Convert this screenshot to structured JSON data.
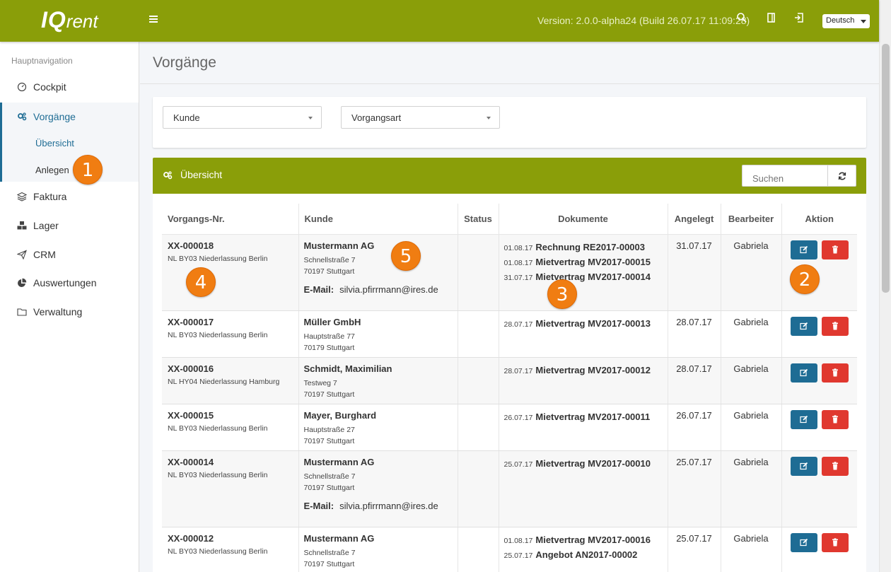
{
  "header": {
    "logo_main": "IQ",
    "logo_sub": "rent",
    "version": "Version: 2.0.0-alpha24 (Build 26.07.17 11:09:28)",
    "language": "Deutsch",
    "icons": [
      "menu-icon",
      "search-icon",
      "bookmark-icon",
      "logout-icon"
    ],
    "accent_color": "#8a9e09"
  },
  "sidebar": {
    "header": "Hauptnavigation",
    "items": [
      {
        "label": "Cockpit",
        "icon": "gauge-icon"
      },
      {
        "label": "Vorgänge",
        "icon": "cogs-icon",
        "active": true
      },
      {
        "label": "Faktura",
        "icon": "layers-icon"
      },
      {
        "label": "Lager",
        "icon": "cubes-icon"
      },
      {
        "label": "CRM",
        "icon": "paper-plane-icon"
      },
      {
        "label": "Auswertungen",
        "icon": "pie-chart-icon"
      },
      {
        "label": "Verwaltung",
        "icon": "folder-icon"
      }
    ],
    "sub_items": [
      {
        "label": "Übersicht",
        "active": true
      },
      {
        "label": "Anlegen"
      }
    ],
    "active_color": "#1e6c94"
  },
  "main": {
    "title": "Vorgänge",
    "filters": [
      {
        "label": "Kunde"
      },
      {
        "label": "Vorgangsart"
      }
    ],
    "panel": {
      "title": "Übersicht",
      "search_placeholder": "Suchen"
    },
    "table": {
      "columns": [
        "Vorgangs-Nr.",
        "Kunde",
        "Status",
        "Dokumente",
        "Angelegt",
        "Bearbeiter",
        "Aktion"
      ],
      "rows": [
        {
          "nr": "XX-000018",
          "branch": "NL BY03 Niederlassung Berlin",
          "customer": "Mustermann AG",
          "street": "Schnellstraße 7",
          "city": "70197 Stuttgart",
          "email_label": "E-Mail:",
          "email": "silvia.pfirrmann@ires.de",
          "status": "",
          "docs": [
            {
              "date": "01.08.17",
              "name": "Rechnung RE2017-00003"
            },
            {
              "date": "01.08.17",
              "name": "Mietvertrag MV2017-00015"
            },
            {
              "date": "31.07.17",
              "name": "Mietvertrag MV2017-00014"
            }
          ],
          "created": "31.07.17",
          "editor": "Gabriela"
        },
        {
          "nr": "XX-000017",
          "branch": "NL BY03 Niederlassung Berlin",
          "customer": "Müller GmbH",
          "street": "Hauptstraße 77",
          "city": "70179 Stuttgart",
          "status": "",
          "docs": [
            {
              "date": "28.07.17",
              "name": "Mietvertrag MV2017-00013"
            }
          ],
          "created": "28.07.17",
          "editor": "Gabriela"
        },
        {
          "nr": "XX-000016",
          "branch": "NL HY04 Niederlassung Hamburg",
          "customer": "Schmidt, Maximilian",
          "street": "Testweg 7",
          "city": "70197 Stuttgart",
          "status": "",
          "docs": [
            {
              "date": "28.07.17",
              "name": "Mietvertrag MV2017-00012"
            }
          ],
          "created": "28.07.17",
          "editor": "Gabriela"
        },
        {
          "nr": "XX-000015",
          "branch": "NL BY03 Niederlassung Berlin",
          "customer": "Mayer, Burghard",
          "street": "Hauptstraße 27",
          "city": "70197 Stuttgart",
          "status": "",
          "docs": [
            {
              "date": "26.07.17",
              "name": "Mietvertrag MV2017-00011"
            }
          ],
          "created": "26.07.17",
          "editor": "Gabriela"
        },
        {
          "nr": "XX-000014",
          "branch": "NL BY03 Niederlassung Berlin",
          "customer": "Mustermann AG",
          "street": "Schnellstraße 7",
          "city": "70197 Stuttgart",
          "email_label": "E-Mail:",
          "email": "silvia.pfirrmann@ires.de",
          "status": "",
          "docs": [
            {
              "date": "25.07.17",
              "name": "Mietvertrag MV2017-00010"
            }
          ],
          "created": "25.07.17",
          "editor": "Gabriela"
        },
        {
          "nr": "XX-000012",
          "branch": "NL BY03 Niederlassung Berlin",
          "customer": "Mustermann AG",
          "street": "Schnellstraße 7",
          "city": "70197 Stuttgart",
          "status": "",
          "docs": [
            {
              "date": "01.08.17",
              "name": "Mietvertrag MV2017-00016"
            },
            {
              "date": "25.07.17",
              "name": "Angebot AN2017-00002"
            }
          ],
          "created": "25.07.17",
          "editor": "Gabriela"
        }
      ]
    }
  },
  "markers": [
    "1",
    "2",
    "3",
    "4",
    "5"
  ],
  "marker_color": "#f07d12"
}
